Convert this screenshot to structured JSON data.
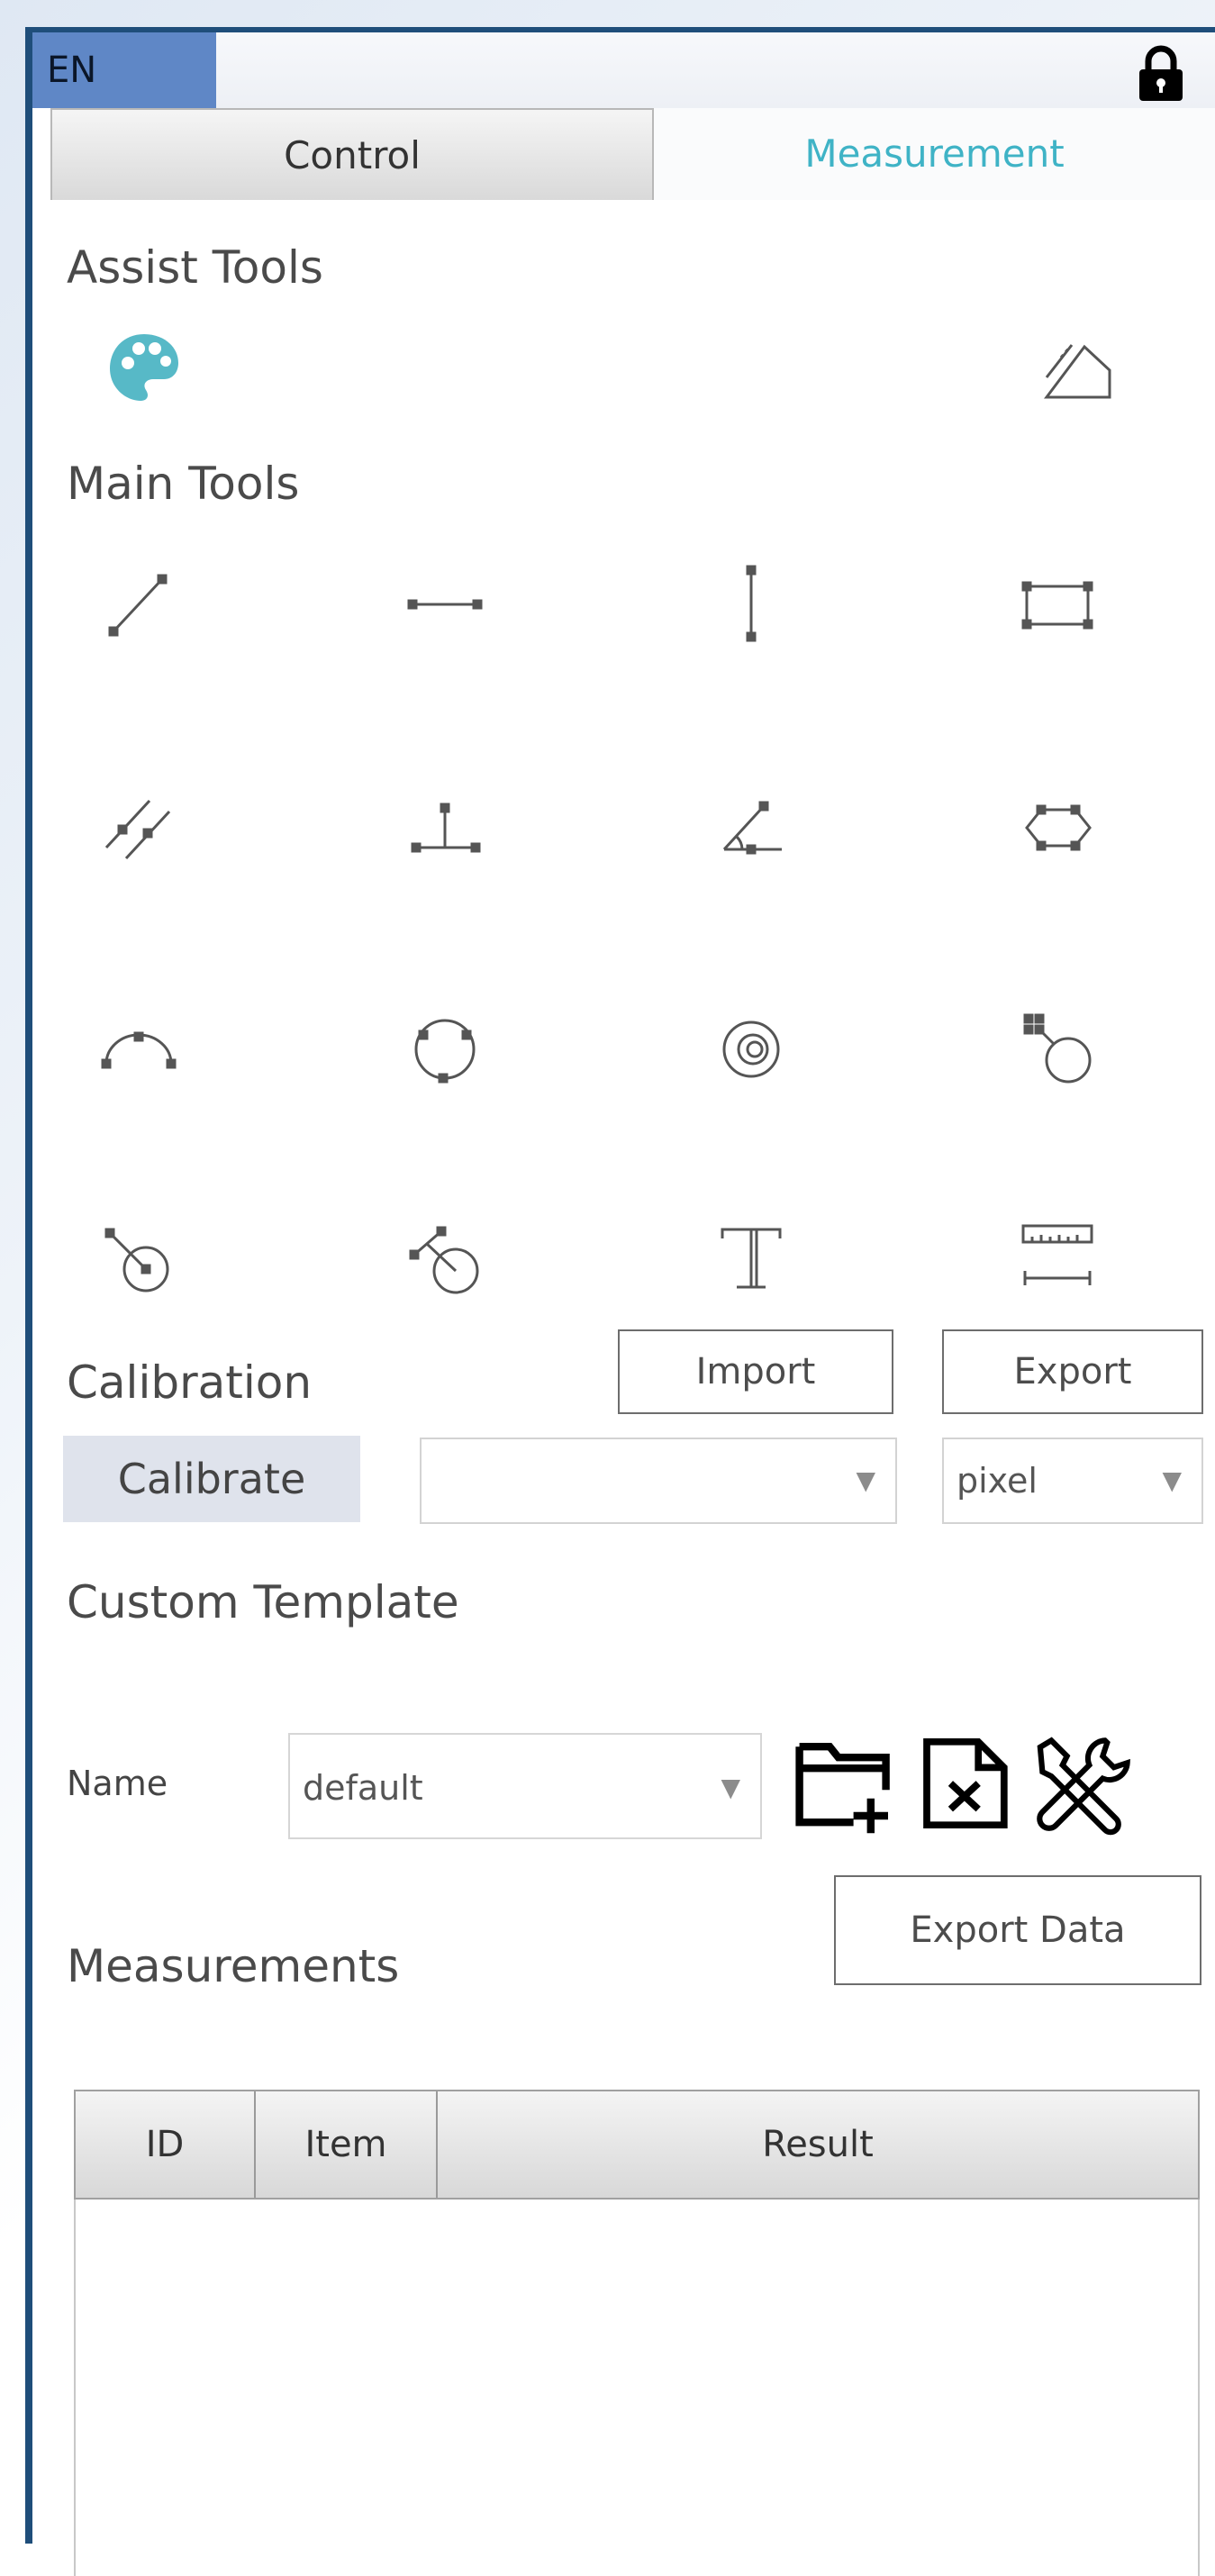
{
  "topbar": {
    "language": "EN",
    "lock_icon": "lock-icon"
  },
  "tabs": [
    {
      "label": "Control",
      "active": false
    },
    {
      "label": "Measurement",
      "active": true
    }
  ],
  "assist_tools": {
    "title": "Assist Tools",
    "icons": [
      "palette-icon",
      "area-shading-icon"
    ]
  },
  "main_tools": {
    "title": "Main Tools",
    "icons": [
      "line-icon",
      "horizontal-line-icon",
      "vertical-line-icon",
      "rectangle-icon",
      "parallel-lines-icon",
      "perpendicular-icon",
      "angle-icon",
      "polygon-icon",
      "arc-icon",
      "circle-icon",
      "concentric-circles-icon",
      "point-to-circle-icon",
      "point-circle-distance-icon",
      "line-circle-distance-icon",
      "text-icon",
      "scale-bar-icon"
    ]
  },
  "calibration": {
    "title": "Calibration",
    "import_label": "Import",
    "export_label": "Export",
    "calibrate_label": "Calibrate",
    "profile_value": "",
    "unit_value": "pixel"
  },
  "custom_template": {
    "title": "Custom Template",
    "name_label": "Name",
    "name_value": "default",
    "action_icons": [
      "new-folder-icon",
      "delete-file-icon",
      "tools-icon"
    ]
  },
  "measurements": {
    "title": "Measurements",
    "export_label": "Export Data",
    "columns": [
      "ID",
      "Item",
      "Result"
    ],
    "rows": []
  },
  "colors": {
    "accent_teal": "#3fb3c6",
    "language_badge": "#5f87c6",
    "frame_blue": "#1f4e7a",
    "icon_gray": "#5a5a5a"
  }
}
